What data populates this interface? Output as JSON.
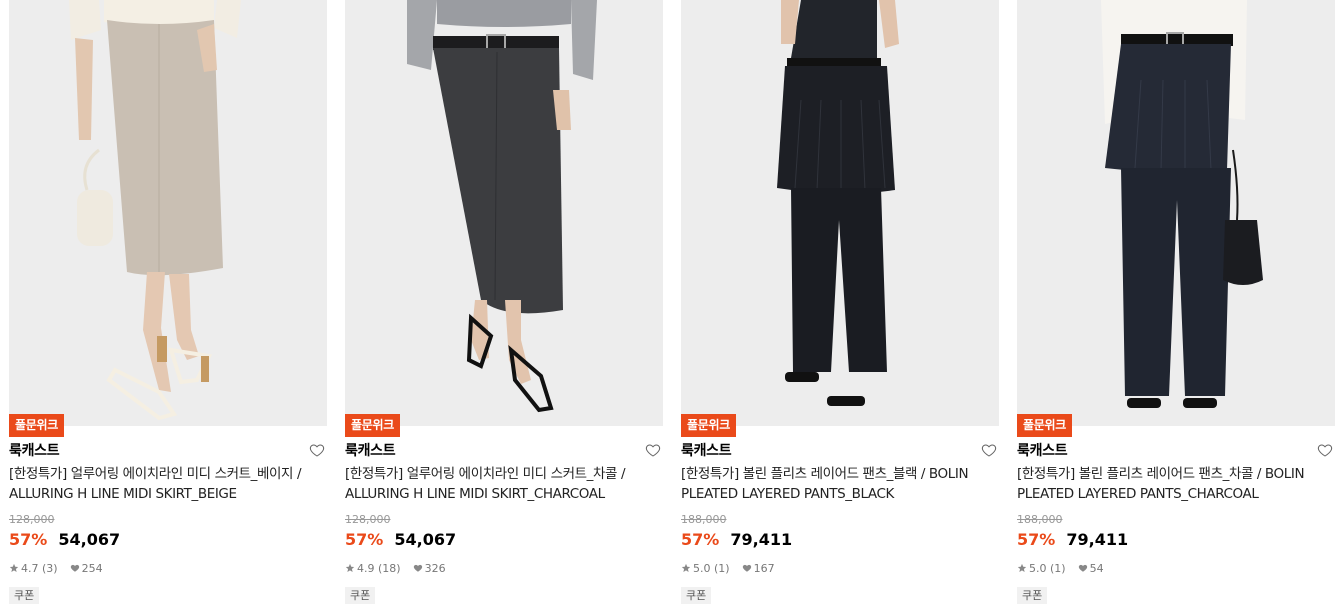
{
  "products": [
    {
      "badge": "풀문위크",
      "brand": "룩캐스트",
      "title": "[한정특가] 얼루어링 에이치라인 미디 스커트_베이지 / ALLURING H LINE MIDI SKIRT_BEIGE",
      "original_price": "128,000",
      "discount": "57%",
      "price": "54,067",
      "rating": "4.7",
      "review_count": "(3)",
      "likes": "254",
      "coupon": "쿠폰",
      "image": "beige-midi-skirt-photo",
      "garment_color": "#c9bfb3"
    },
    {
      "badge": "풀문위크",
      "brand": "룩캐스트",
      "title": "[한정특가] 얼루어링 에이치라인 미디 스커트_차콜 / ALLURING H LINE MIDI SKIRT_CHARCOAL",
      "original_price": "128,000",
      "discount": "57%",
      "price": "54,067",
      "rating": "4.9",
      "review_count": "(18)",
      "likes": "326",
      "coupon": "쿠폰",
      "image": "charcoal-midi-skirt-photo",
      "garment_color": "#3c3d40"
    },
    {
      "badge": "풀문위크",
      "brand": "룩캐스트",
      "title": "[한정특가] 볼린 플리츠 레이어드 팬츠_블랙 / BOLIN PLEATED LAYERED PANTS_BLACK",
      "original_price": "188,000",
      "discount": "57%",
      "price": "79,411",
      "rating": "5.0",
      "review_count": "(1)",
      "likes": "167",
      "coupon": "쿠폰",
      "image": "black-layered-pants-photo",
      "garment_color": "#1d1f25"
    },
    {
      "badge": "풀문위크",
      "brand": "룩캐스트",
      "title": "[한정특가] 볼린 플리츠 레이어드 팬츠_차콜 / BOLIN PLEATED LAYERED PANTS_CHARCOAL",
      "original_price": "188,000",
      "discount": "57%",
      "price": "79,411",
      "rating": "5.0",
      "review_count": "(1)",
      "likes": "54",
      "coupon": "쿠폰",
      "image": "charcoal-layered-pants-photo",
      "garment_color": "#252a36"
    }
  ],
  "colors": {
    "accent": "#ea4a1a",
    "strike": "#999999",
    "meta": "#777777",
    "coupon_bg": "#f1f1f1"
  },
  "icons": {
    "wishlist": "heart-outline-icon",
    "rating": "star-icon",
    "likes": "heart-filled-icon"
  }
}
